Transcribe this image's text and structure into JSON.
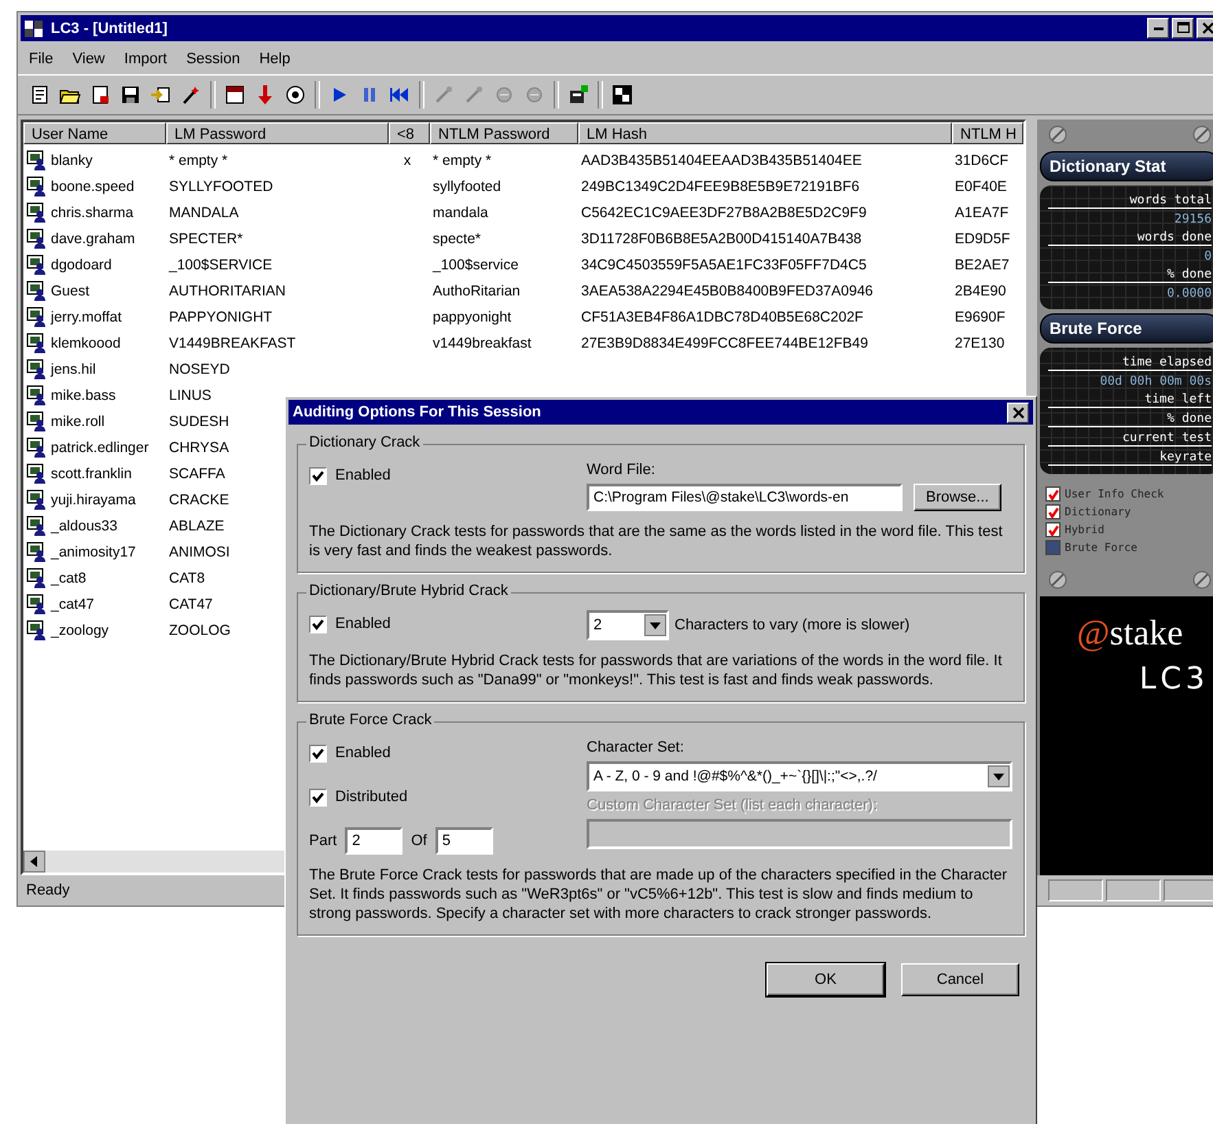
{
  "window": {
    "title": "LC3 - [Untitled1]"
  },
  "menu": [
    "File",
    "View",
    "Import",
    "Session",
    "Help"
  ],
  "table": {
    "columns": [
      "User Name",
      "LM Password",
      "<8",
      "NTLM Password",
      "LM Hash",
      "NTLM H"
    ],
    "rows": [
      {
        "cells": [
          "blanky",
          "* empty *",
          "x",
          "* empty *",
          "AAD3B435B51404EEAAD3B435B51404EE",
          "31D6CF"
        ]
      },
      {
        "cells": [
          "boone.speed",
          "SYLLYFOOTED",
          "",
          "syllyfooted",
          "249BC1349C2D4FEE9B8E5B9E72191BF6",
          "E0F40E"
        ]
      },
      {
        "cells": [
          "chris.sharma",
          "MANDALA",
          "",
          "mandala",
          "C5642EC1C9AEE3DF27B8A2B8E5D2C9F9",
          "A1EA7F"
        ]
      },
      {
        "cells": [
          "dave.graham",
          "SPECTER*",
          "",
          "specte*",
          "3D11728F0B6B8E5A2B00D415140A7B438",
          "ED9D5F"
        ]
      },
      {
        "cells": [
          "dgodoard",
          "_100$SERVICE",
          "",
          "_100$service",
          "34C9C4503559F5A5AE1FC33F05FF7D4C5",
          "BE2AE7"
        ]
      },
      {
        "cells": [
          "Guest",
          "AUTHORITARIAN",
          "",
          "AuthoRitarian",
          "3AEA538A2294E45B0B8400B9FED37A0946",
          "2B4E90"
        ]
      },
      {
        "cells": [
          "jerry.moffat",
          "PAPPYONIGHT",
          "",
          "pappyonight",
          "CF51A3EB4F86A1DBC78D40B5E68C202F",
          "E9690F"
        ]
      },
      {
        "cells": [
          "klemkoood",
          "V1449BREAKFAST",
          "",
          "v1449breakfast",
          "27E3B9D8834E499FCC8FEE744BE12FB49",
          "27E130"
        ]
      },
      {
        "cells": [
          "jens.hil",
          "NOSEYD"
        ]
      },
      {
        "cells": [
          "mike.bass",
          "LINUS"
        ]
      },
      {
        "cells": [
          "mike.roll",
          "SUDESH"
        ]
      },
      {
        "cells": [
          "patrick.edlinger",
          "CHRYSA"
        ]
      },
      {
        "cells": [
          "scott.franklin",
          "SCAFFA"
        ]
      },
      {
        "cells": [
          "yuji.hirayama",
          "CRACKE"
        ]
      },
      {
        "cells": [
          "_aldous33",
          "ABLAZE"
        ]
      },
      {
        "cells": [
          "_animosity17",
          "ANIMOSI"
        ]
      },
      {
        "cells": [
          "_cat8",
          "CAT8"
        ]
      },
      {
        "cells": [
          "_cat47",
          "CAT47"
        ]
      },
      {
        "cells": [
          "_zoology",
          "ZOOLOG"
        ]
      }
    ]
  },
  "status_bar": {
    "text": "Ready"
  },
  "side_panel": {
    "dictionary_status": {
      "title": "Dictionary Stat",
      "fields": [
        {
          "label": "words total",
          "value": "29156"
        },
        {
          "label": "words done",
          "value": "0"
        },
        {
          "label": "% done",
          "value": "0.0000"
        }
      ]
    },
    "brute_force": {
      "title": "Brute Force",
      "fields": [
        {
          "label": "time elapsed",
          "value": "00d 00h 00m 00s"
        },
        {
          "label": "time left"
        },
        {
          "label": "% done"
        },
        {
          "label": "current test"
        },
        {
          "label": "keyrate"
        }
      ]
    },
    "legend": [
      {
        "label": "User Info Check",
        "checked": true
      },
      {
        "label": "Dictionary",
        "checked": true
      },
      {
        "label": "Hybrid",
        "checked": true
      },
      {
        "label": "Brute Force",
        "checked": false
      }
    ],
    "logo": {
      "mark": "@",
      "name": "stake",
      "product": "LC3"
    }
  },
  "dialog": {
    "title": "Auditing Options For This Session",
    "dictionary": {
      "legend": "Dictionary Crack",
      "enabled": {
        "label": "Enabled",
        "checked": true
      },
      "word_file_label": "Word File:",
      "word_file": "C:\\Program Files\\@stake\\LC3\\words-en",
      "browse": "Browse...",
      "description": "The Dictionary Crack tests for passwords that are the same as the words listed in the word file. This test is very fast and finds the weakest passwords."
    },
    "hybrid": {
      "legend": "Dictionary/Brute Hybrid Crack",
      "enabled": {
        "label": "Enabled",
        "checked": true
      },
      "chars": "2",
      "chars_label": "Characters to vary (more is slower)",
      "description": "The Dictionary/Brute Hybrid Crack tests for passwords that are variations of the words in the word file. It finds passwords such as \"Dana99\" or \"monkeys!\". This test is fast and finds weak passwords."
    },
    "brute": {
      "legend": "Brute Force Crack",
      "enabled": {
        "label": "Enabled",
        "checked": true
      },
      "distributed": {
        "label": "Distributed",
        "checked": true
      },
      "part_label": "Part",
      "part": "2",
      "of_label": "Of",
      "of": "5",
      "charset_label": "Character Set:",
      "charset": "A - Z, 0 - 9 and !@#$%^&*()_+~`{}[]\\|:;\"<>,.?/",
      "custom_label": "Custom Character Set (list each character):",
      "custom_disabled": true,
      "description": "The Brute Force Crack tests for passwords that are made up of the characters specified in the Character Set. It finds passwords such as \"WeR3pt6s\" or \"vC5%6+12b\". This test is slow and finds medium to strong passwords. Specify a character set with more characters to crack stronger passwords."
    },
    "buttons": [
      "OK",
      "Cancel"
    ]
  }
}
